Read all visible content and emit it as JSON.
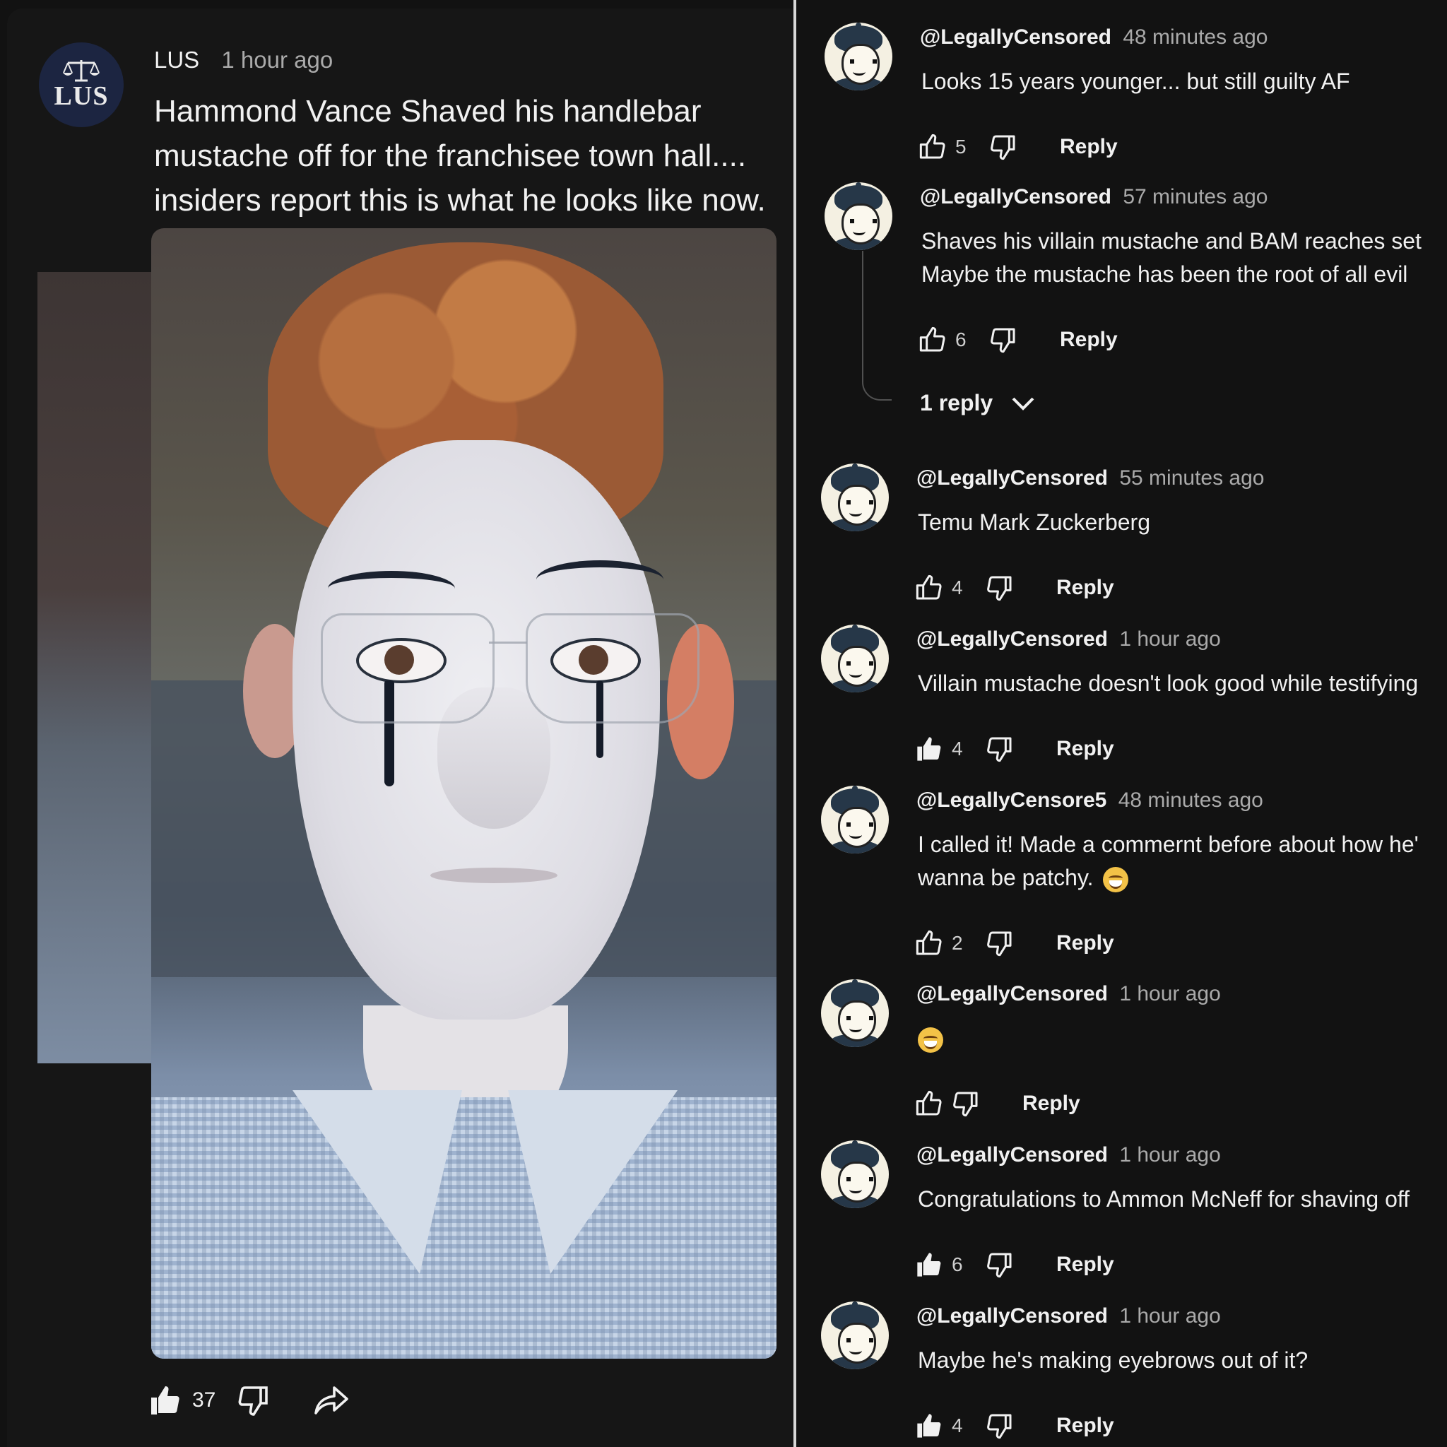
{
  "post": {
    "author": "LUS",
    "avatar_text": "LUS",
    "time": "1 hour ago",
    "text": "Hammond Vance Shaved his handlebar mustache off for the franchisee town hall.... insiders report this is what he looks like now.",
    "likes": "37"
  },
  "thread": {
    "replies_label": "1 reply",
    "reply_label": "Reply"
  },
  "comments": [
    {
      "handle": "@LegallyCensored",
      "time": "48 minutes ago",
      "text": "Looks 15 years younger... but still guilty AF",
      "likes": "5",
      "liked": false
    },
    {
      "handle": "@LegallyCensored",
      "time": "57 minutes ago",
      "text": "Shaves his villain mustache and BAM reaches set\nMaybe the mustache has been the root of all evil",
      "likes": "6",
      "liked": false
    },
    {
      "handle": "@LegallyCensored",
      "time": "55 minutes ago",
      "text": "Temu Mark Zuckerberg",
      "likes": "4",
      "liked": false
    },
    {
      "handle": "@LegallyCensored",
      "time": "1 hour ago",
      "text": "Villain mustache doesn't look good while testifying",
      "likes": "4",
      "liked": true
    },
    {
      "handle": "@LegallyCensore5",
      "time": "48 minutes ago",
      "text": "I called it! Made a commernt before about how he'\nwanna be patchy.",
      "likes": "2",
      "liked": false
    },
    {
      "handle": "@LegallyCensored",
      "time": "1 hour ago",
      "text": "",
      "likes": "",
      "liked": false
    },
    {
      "handle": "@LegallyCensored",
      "time": "1 hour ago",
      "text": "Congratulations to Ammon McNeff for shaving off",
      "likes": "6",
      "liked": true
    },
    {
      "handle": "@LegallyCensored",
      "time": "1 hour ago",
      "text": "Maybe he's making eyebrows out of it?",
      "likes": "4",
      "liked": true
    }
  ],
  "icons": {
    "like": "thumbs-up-icon",
    "dislike": "thumbs-down-icon",
    "share": "share-icon",
    "expand": "chevron-down-icon",
    "emoji": "grinning-emoji-icon",
    "post_avatar": "scales-of-justice-icon"
  },
  "colors": {
    "background": "#121212",
    "text": "#f1f1f1",
    "muted": "#aaaaaa",
    "avatar_bg": "#1c2541"
  }
}
